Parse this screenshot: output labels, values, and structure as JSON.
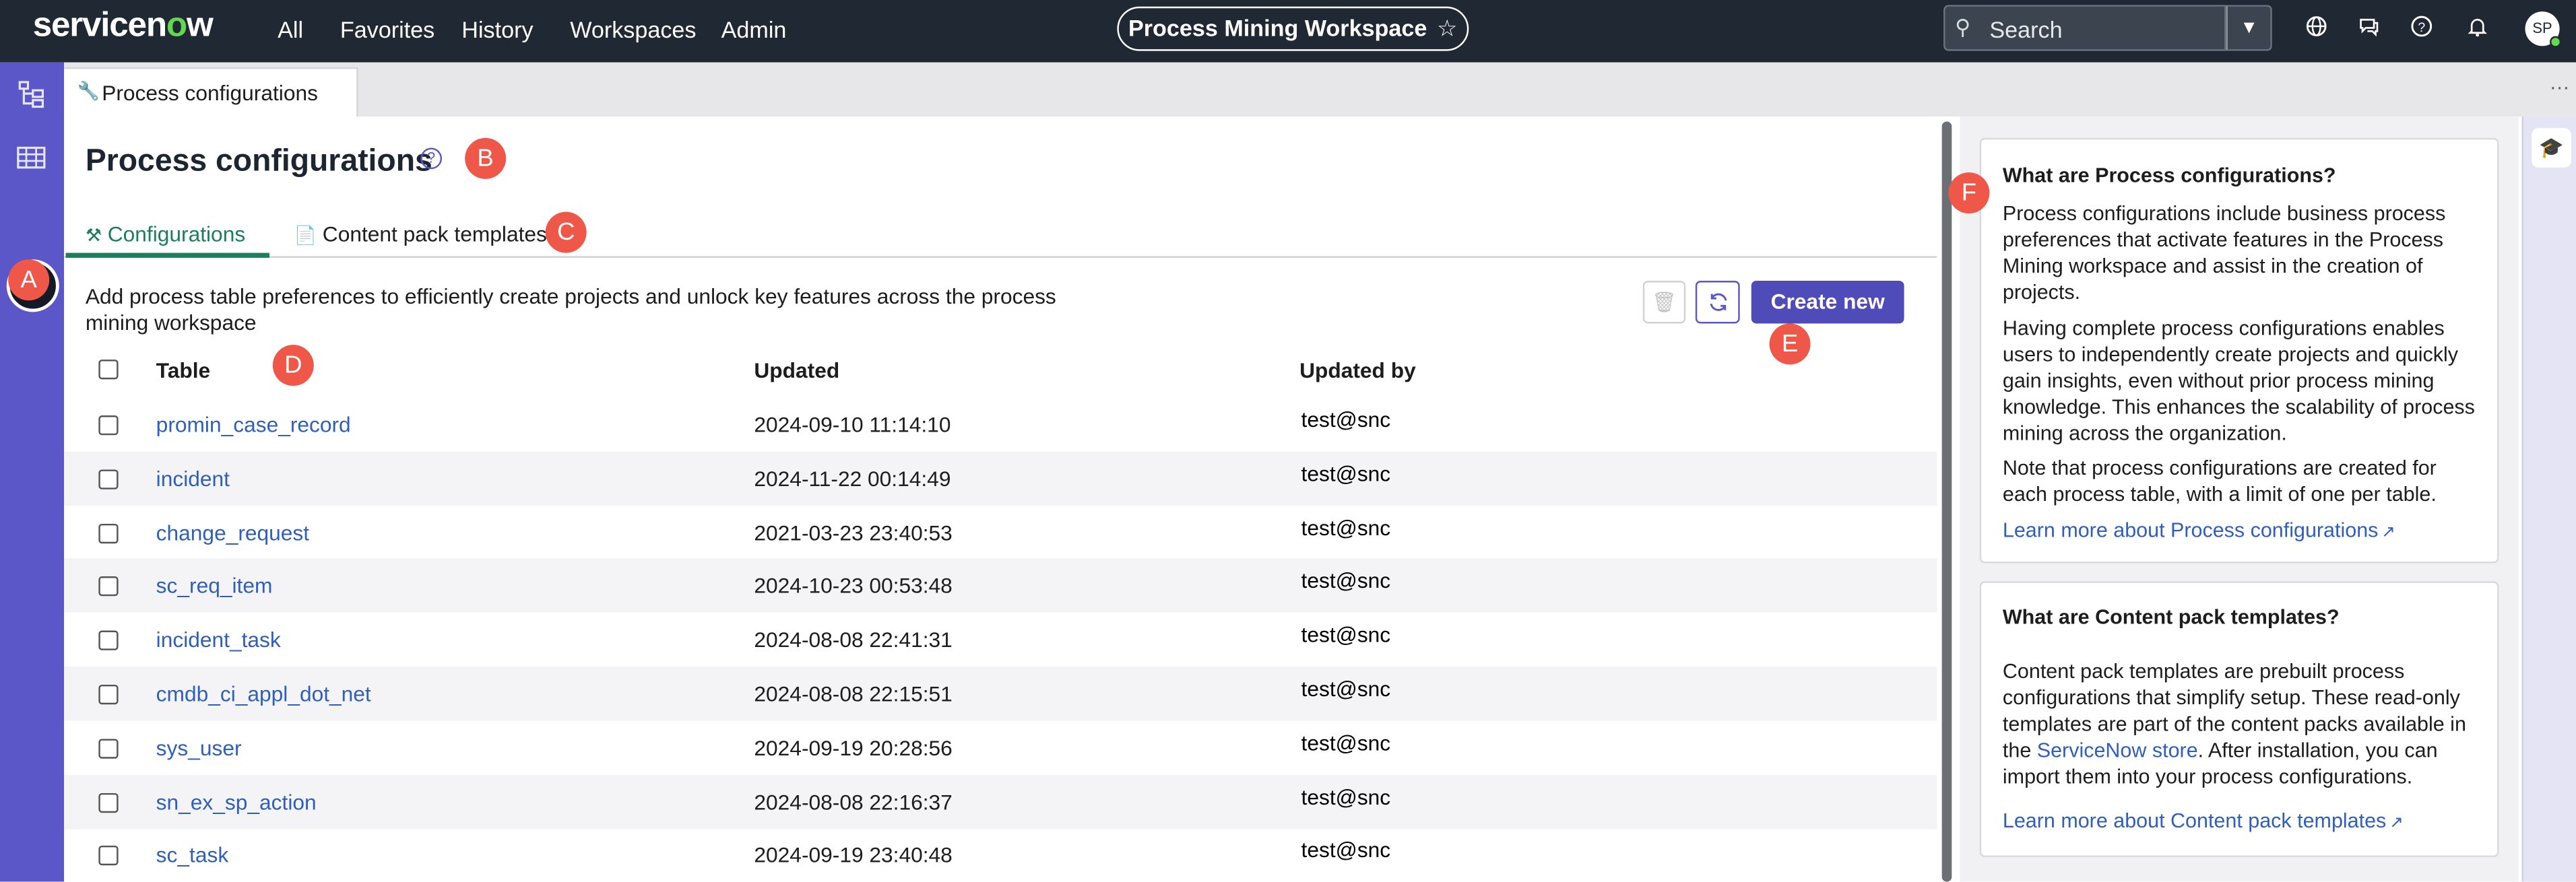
{
  "topnav": {
    "brand_pre": "servicen",
    "brand_o": "o",
    "brand_post": "w",
    "links": [
      "All",
      "Favorites",
      "History",
      "Workspaces",
      "Admin"
    ],
    "workspace_title": "Process Mining Workspace",
    "search_placeholder": "Search",
    "avatar_initials": "SP",
    "icons": [
      "globe-icon",
      "chat-icon",
      "help-icon",
      "bell-icon"
    ]
  },
  "rail": {
    "icons": [
      "tree-icon",
      "table-icon",
      "wrench-icon"
    ]
  },
  "page_tab": {
    "label": "Process configurations"
  },
  "main": {
    "title": "Process configurations",
    "tabs": [
      "Configurations",
      "Content pack templates"
    ],
    "description": "Add process table preferences to efficiently create projects and unlock key features across the process mining workspace",
    "create_button": "Create new",
    "table": {
      "columns": [
        "Table",
        "Updated",
        "Updated by"
      ],
      "rows": [
        {
          "table": "promin_case_record",
          "updated": "2024-09-10 11:14:10",
          "updated_by": "test@snc"
        },
        {
          "table": "incident",
          "updated": "2024-11-22 00:14:49",
          "updated_by": "test@snc"
        },
        {
          "table": "change_request",
          "updated": "2021-03-23 23:40:53",
          "updated_by": "test@snc"
        },
        {
          "table": "sc_req_item",
          "updated": "2024-10-23 00:53:48",
          "updated_by": "test@snc"
        },
        {
          "table": "incident_task",
          "updated": "2024-08-08 22:41:31",
          "updated_by": "test@snc"
        },
        {
          "table": "cmdb_ci_appl_dot_net",
          "updated": "2024-08-08 22:15:51",
          "updated_by": "test@snc"
        },
        {
          "table": "sys_user",
          "updated": "2024-09-19 20:28:56",
          "updated_by": "test@snc"
        },
        {
          "table": "sn_ex_sp_action",
          "updated": "2024-08-08 22:16:37",
          "updated_by": "test@snc"
        },
        {
          "table": "sc_task",
          "updated": "2024-09-19 23:40:48",
          "updated_by": "test@snc"
        }
      ]
    }
  },
  "side_panel": {
    "card1": {
      "title": "What are Process configurations?",
      "p1": "Process configurations include business process preferences that activate features in the Process Mining workspace and assist in the creation of projects.",
      "p2": "Having complete process configurations enables users to independently create projects and quickly gain insights, even without prior process mining knowledge. This enhances the scalability of process mining across the organization.",
      "p3": "Note that process configurations are created for each process table, with a limit of one per table.",
      "link": "Learn more about Process configurations"
    },
    "card2": {
      "title": "What are Content pack templates?",
      "p1_a": "Content pack templates are prebuilt process configurations that simplify setup. These read-only templates are part of the content packs available in the ",
      "p1_link": "ServiceNow store",
      "p1_b": ". After installation, you can import them into your process configurations.",
      "link": "Learn more about Content pack templates"
    }
  },
  "markers": [
    "A",
    "B",
    "C",
    "D",
    "E",
    "F"
  ],
  "colors": {
    "nav_bg": "#1f2833",
    "rail_bg": "#5b57c8",
    "accent_green": "#1a7f5a",
    "primary_button": "#4f4bb8",
    "link": "#2f5fbb",
    "marker": "#ef5848"
  }
}
